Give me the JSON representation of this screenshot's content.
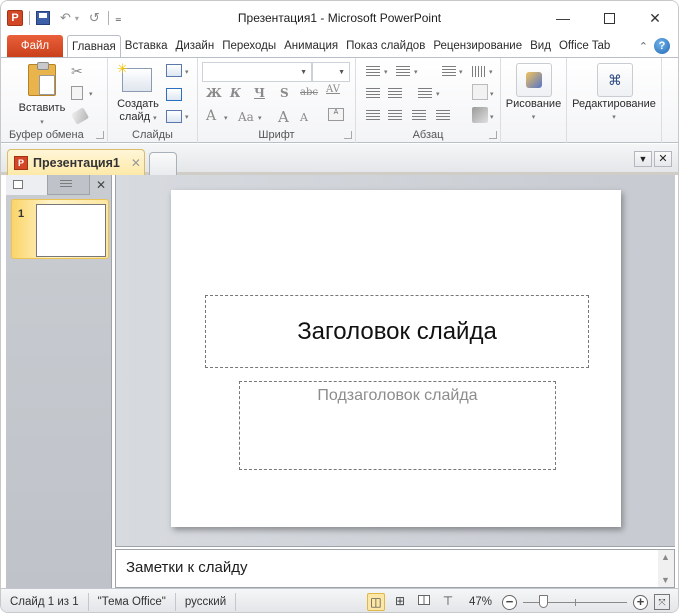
{
  "window": {
    "title": "Презентация1  -  Microsoft PowerPoint",
    "app_icon": "P",
    "controls": {
      "minimize": "—",
      "maximize": "□",
      "close": "✕"
    }
  },
  "qat": {
    "save_icon": "save-icon",
    "undo_glyph": "↶",
    "undo_dropdown": "▾",
    "redo_glyph": "↺",
    "customize_glyph": "₌"
  },
  "ribbon_tabs": {
    "file": "Файл",
    "tabs": [
      "Главная",
      "Вставка",
      "Дизайн",
      "Переходы",
      "Анимация",
      "Показ слайдов",
      "Рецензирование",
      "Вид",
      "Office Tab"
    ],
    "active": "Главная",
    "collapse_glyph": "⌃",
    "help_glyph": "?"
  },
  "ribbon": {
    "clipboard": {
      "label": "Буфер обмена",
      "paste": "Вставить",
      "cut_glyph": "✂",
      "dd": "▾"
    },
    "slides": {
      "label": "Слайды",
      "new_slide_line1": "Создать",
      "new_slide_line2": "слайд",
      "dd": "▾"
    },
    "font": {
      "label": "Шрифт",
      "font_name": "",
      "font_size": "",
      "bold": "Ж",
      "italic": "К",
      "underline": "Ч",
      "shadow": "S",
      "strike": "abc",
      "spacing": "AV",
      "font_color": "A",
      "change_case": "Aa",
      "grow": "A",
      "shrink": "A",
      "clear": "A"
    },
    "paragraph": {
      "label": "Абзац"
    },
    "drawing": {
      "label": "Рисование",
      "dd": "▾"
    },
    "editing": {
      "label": "Редактирование",
      "dd": "▾"
    }
  },
  "doc_tabs": {
    "tabs": [
      {
        "label": "Презентация1",
        "close": "✕"
      }
    ],
    "menu_glyph": "▼",
    "close_glyph": "✕"
  },
  "left_pane": {
    "close_glyph": "✕",
    "thumbnails": [
      {
        "number": "1"
      }
    ]
  },
  "slide": {
    "title": "Заголовок слайда",
    "subtitle": "Подзаголовок слайда"
  },
  "notes": {
    "placeholder": "Заметки к слайду",
    "scroll_up": "▲",
    "scroll_down": "▼"
  },
  "status": {
    "slide_info": "Слайд 1 из 1",
    "theme": "\"Тема Office\"",
    "language": "русский",
    "view_glyphs": {
      "normal": "◫",
      "sorter": "⊞",
      "reading": "📖",
      "slideshow": "⊤"
    },
    "zoom": "47%",
    "zoom_percent": 47,
    "zoom_out": "−",
    "zoom_in": "+",
    "fit_glyph": "⤧"
  }
}
